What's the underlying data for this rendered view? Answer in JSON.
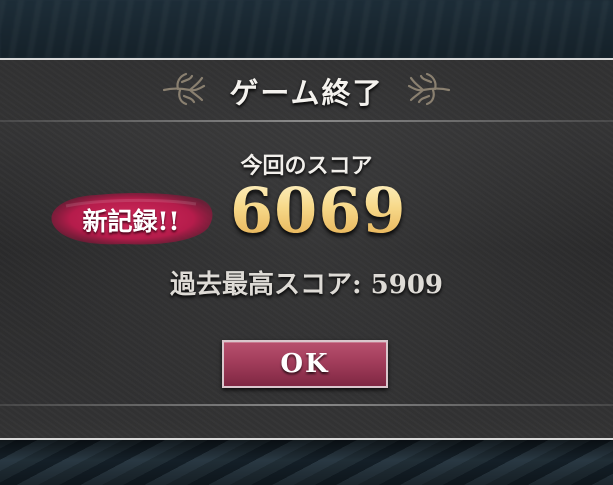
{
  "dialog": {
    "title": "ゲーム終了",
    "current_score_label": "今回のスコア",
    "current_score_value": "6069",
    "new_record_badge": "新記録!!",
    "best_score_label": "過去最高スコア",
    "best_score_separator": ":",
    "best_score_value": "5909",
    "ok_button_label": "OK"
  },
  "colors": {
    "badge": "#c0214f",
    "button": "#a23d5b",
    "score_gold": "#f7d98a"
  },
  "icons": {
    "title_ornament_left": "ornament-left-icon",
    "title_ornament_right": "ornament-right-icon"
  }
}
